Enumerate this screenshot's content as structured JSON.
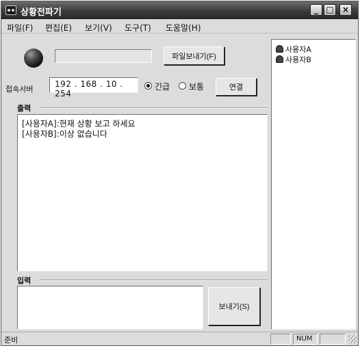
{
  "window": {
    "title": "상황전파기"
  },
  "title_buttons": [
    "_",
    "□",
    "×"
  ],
  "menu": [
    "파일(F)",
    "편집(E)",
    "보기(V)",
    "도구(T)",
    "도움말(H)"
  ],
  "send_file_button": "파일보내기(F)",
  "server": {
    "label": "접속서버",
    "ip": "192 . 168 .  10 . 254"
  },
  "priority": {
    "options": [
      "긴급",
      "보통"
    ],
    "selected": "긴급"
  },
  "connect_button": "연결",
  "output": {
    "label": "출력",
    "messages": [
      "[사용자A]:현재 상황 보고 하세요",
      "[사용자B]:이상 없습니다"
    ]
  },
  "input": {
    "label": "입력",
    "value": ""
  },
  "send_button": "보내기(S)",
  "users": [
    "사용자A",
    "사용자B"
  ],
  "status": {
    "text": "준비",
    "num": "NUM"
  }
}
